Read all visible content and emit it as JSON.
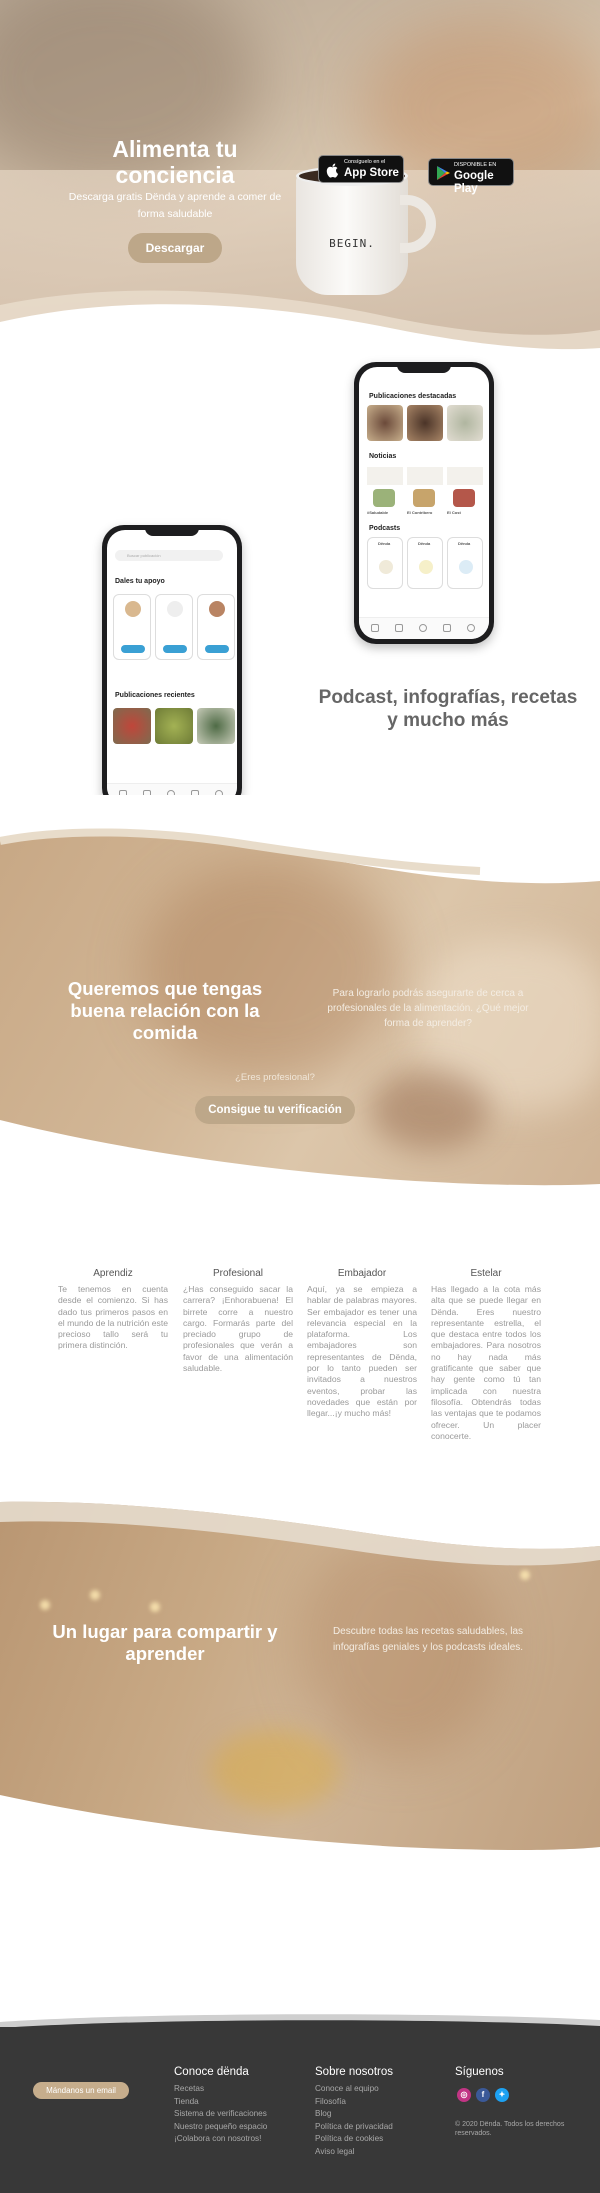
{
  "hero": {
    "title": "Alimenta tu conciencia",
    "subtitle": "Descarga gratis Dënda y aprende a comer de forma saludable",
    "download_label": "Descargar",
    "mug_text": "BEGIN.",
    "appstore": {
      "small": "Consíguelo en el",
      "large": "App Store"
    },
    "googleplay": {
      "small": "DISPONIBLE EN",
      "large": "Google Play"
    }
  },
  "phone_right": {
    "section1": "Publicaciones destacadas",
    "section2": "Noticias",
    "section3": "Podcasts",
    "news": [
      "#Saludable",
      "El Contribero",
      "El Cost"
    ],
    "podcasts": [
      "Dënda",
      "Dënda",
      "Dënda"
    ]
  },
  "phone_left": {
    "search_placeholder": "Buscar publicación",
    "section1": "Dales tu apoyo",
    "section2": "Publicaciones recientes",
    "support_button": "Apoyar"
  },
  "podcast_heading": "Podcast, infografías, recetas y mucho más",
  "relation": {
    "title": "Queremos que tengas buena relación con la comida",
    "text": "Para lograrlo podrás asegurarte de cerca a profesionales de la alimentación. ¿Qué mejor forma de aprender?",
    "question": "¿Eres profesional?",
    "button": "Consigue tu verificación"
  },
  "levels": [
    {
      "title": "Aprendiz",
      "text": "Te tenemos en cuenta desde el comienzo. Si has dado tus primeros pasos en el mundo de la nutrición este precioso tallo será tu primera distinción."
    },
    {
      "title": "Profesional",
      "text": "¿Has conseguido sacar la carrera? ¡Enhorabuena! El birrete corre a nuestro cargo. Formarás parte del preciado grupo de profesionales que verán a favor de una alimentación saludable."
    },
    {
      "title": "Embajador",
      "text": "Aquí, ya se empieza a hablar de palabras mayores. Ser embajador es tener una relevancia especial en la plataforma. Los embajadores son representantes de Dënda, por lo tanto pueden ser invitados a nuestros eventos, probar las novedades que están por llegar...¡y mucho más!"
    },
    {
      "title": "Estelar",
      "text": "Has llegado a la cota más alta que se puede llegar en Dënda. Eres nuestro representante estrella, el que destaca entre todos los embajadores. Para nosotros no hay nada más gratificante que saber que hay gente como tú tan implicada con nuestra filosofía. Obtendrás todas las ventajas que te podamos ofrecer. Un placer conocerte."
    }
  ],
  "share": {
    "title": "Un lugar para compartir y aprender",
    "text": "Descubre todas las recetas saludables, las infografías geniales y los podcasts ideales."
  },
  "footer": {
    "mail_button": "Mándanos un email",
    "col1": {
      "title": "Conoce dënda",
      "links": [
        "Recetas",
        "Tienda",
        "Sistema de verificaciones",
        "Nuestro pequeño espacio",
        "¡Colabora con nosotros!"
      ]
    },
    "col2": {
      "title": "Sobre nosotros",
      "links": [
        "Conoce al equipo",
        "Filosofía",
        "Blog",
        "Política de privacidad",
        "Política de cookies",
        "Aviso legal"
      ]
    },
    "col3": {
      "title": "Síguenos"
    },
    "copyright": "© 2020 Dënda. Todos los derechos reservados.",
    "colors": {
      "instagram": "#c13584",
      "facebook": "#3b5998",
      "twitter": "#1da1f2"
    }
  }
}
